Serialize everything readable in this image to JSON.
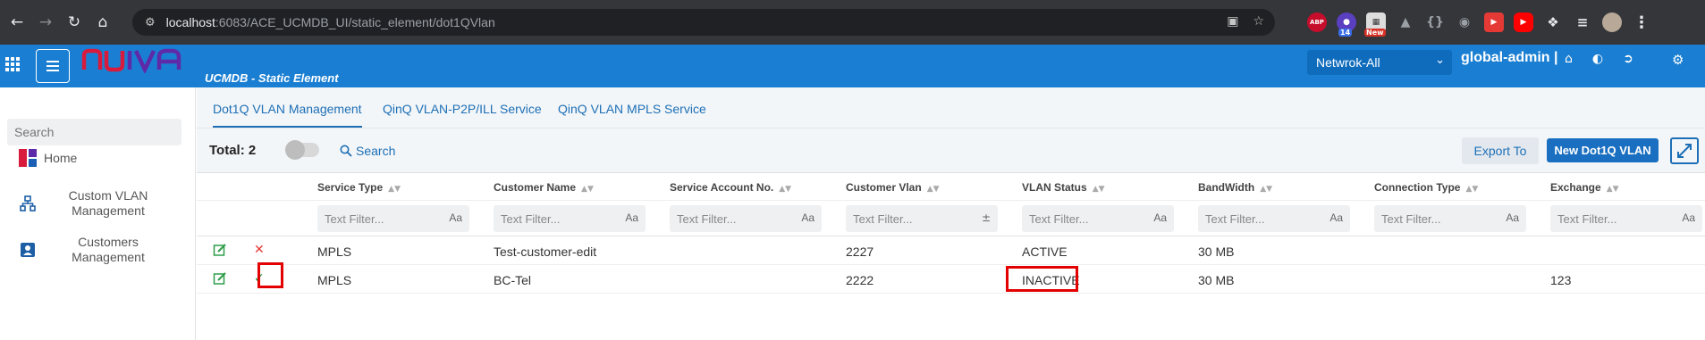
{
  "browser": {
    "url_host": "localhost",
    "url_path": ":6083/ACE_UCMDB_UI/static_element/dot1QVlan",
    "extensions": {
      "abp": "ABP",
      "count_badge": "14",
      "new_badge": "New"
    }
  },
  "header": {
    "app_title": "UCMDB - Static Element",
    "network_select": "Netwrok-All",
    "user": "global-admin |"
  },
  "sidebar": {
    "search_placeholder": "Search",
    "items": [
      {
        "label": "Home"
      },
      {
        "label": "Custom VLAN Management"
      },
      {
        "label": "Customers Management"
      }
    ]
  },
  "tabs": [
    {
      "label": "Dot1Q VLAN Management",
      "active": true
    },
    {
      "label": "QinQ VLAN-P2P/ILL Service",
      "active": false
    },
    {
      "label": "QinQ VLAN MPLS Service",
      "active": false
    }
  ],
  "toolbar": {
    "total": "Total: 2",
    "search_label": "Search",
    "export_label": "Export To",
    "new_label": "New Dot1Q VLAN"
  },
  "table": {
    "columns": [
      "Service Type",
      "Customer Name",
      "Service Account No.",
      "Customer Vlan",
      "VLAN Status",
      "BandWidth",
      "Connection Type",
      "Exchange"
    ],
    "filter_placeholder": "Text Filter...",
    "filter_case_label": "Aa",
    "rows": [
      {
        "service_type": "MPLS",
        "customer_name": "Test-customer-edit",
        "service_account": "",
        "customer_vlan": "2227",
        "vlan_status": "ACTIVE",
        "bandwidth": "30 MB",
        "connection_type": "",
        "exchange": ""
      },
      {
        "service_type": "MPLS",
        "customer_name": "BC-Tel",
        "service_account": "",
        "customer_vlan": "2222",
        "vlan_status": "INACTIVE",
        "bandwidth": "30 MB",
        "connection_type": "",
        "exchange": "123"
      }
    ]
  },
  "colors": {
    "header_blue": "#1a7fd2",
    "link_blue": "#1d6fb5",
    "highlight_red": "#e30000",
    "cross_red": "#e53935",
    "check_green": "#1e9e3a"
  }
}
